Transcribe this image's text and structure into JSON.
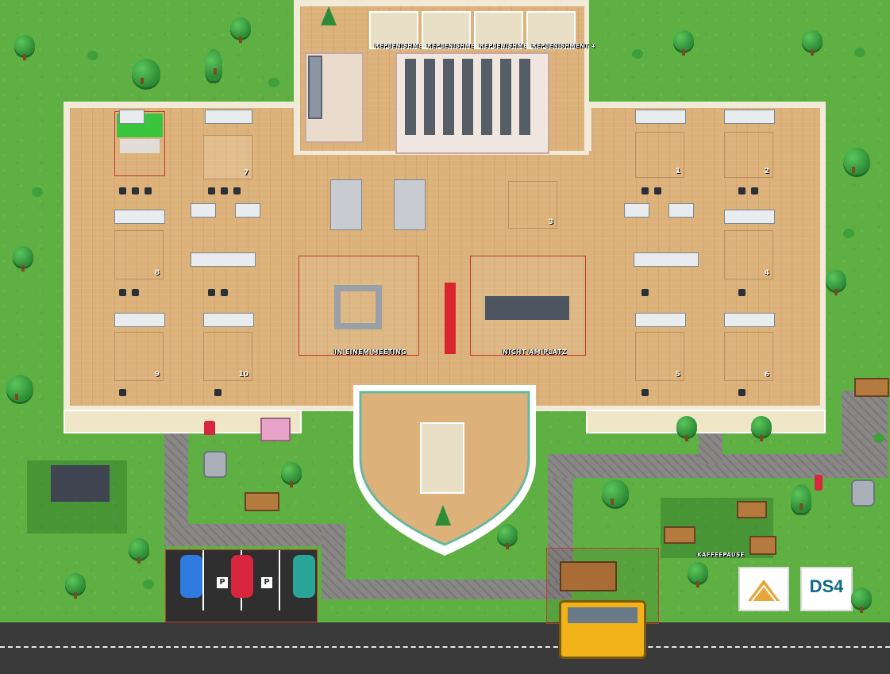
{
  "map": {
    "rooms": {
      "replenishment": [
        "REPLENISHMENT 1",
        "REPLENISHMENT 2",
        "REPLENISHMENT 3",
        "REPLENISHMENT 4"
      ],
      "in_einem_meeting": "IN EINEM MEETING",
      "nicht_am_platz": "NICHT AM PLATZ",
      "kaffeepause": "KAFFEEPAUSE"
    },
    "offices": [
      "1",
      "2",
      "3",
      "4",
      "5",
      "6",
      "7",
      "8",
      "9",
      "10"
    ],
    "parking_sign": "P",
    "logos": {
      "ds4": "DS4"
    },
    "icon_names": [
      "tree-icon",
      "car-icon",
      "bus-icon",
      "fountain-icon",
      "bench-icon",
      "desk-icon",
      "chair-icon",
      "christmas-tree-icon",
      "fire-hydrant-icon",
      "mailbox-icon",
      "bus-stop-icon",
      "gym-icon"
    ],
    "colors": {
      "grass": "#5fb042",
      "floor": "#dcb27a",
      "road": "#3a3a3a",
      "path": "#8a8886",
      "meeting_border": "#c0392b",
      "car_blue": "#2f7be0",
      "car_red": "#d7263d",
      "car_teal": "#2aa59a",
      "bus": "#f2b31a"
    }
  }
}
